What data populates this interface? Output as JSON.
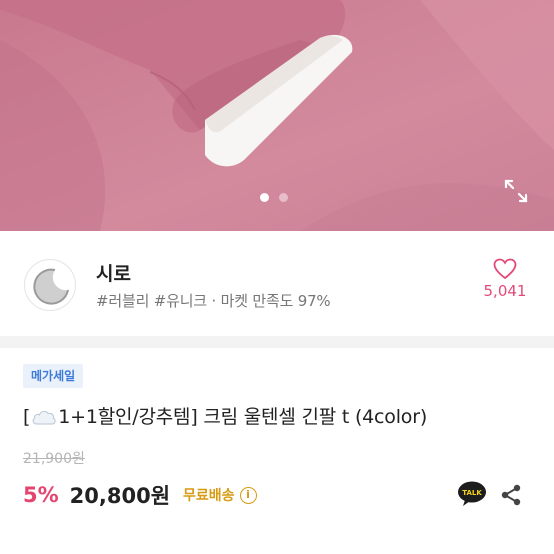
{
  "pager": {
    "count": 2,
    "active": 0
  },
  "seller": {
    "name": "시로",
    "tags": "#러블리 #유니크 · 마켓 만족도 97%",
    "like_count": "5,041"
  },
  "product": {
    "badge": "메가세일",
    "title_prefix": "[",
    "title_main": "1+1할인/강추템] 크림 울텐셀 긴팔 t (4color)",
    "original_price": "21,900원",
    "discount": "5%",
    "price": "20,800원",
    "shipping": "무료배송",
    "talk_label": "TALK"
  },
  "colors": {
    "accent_pink": "#e5446f",
    "badge_blue": "#3d7bd9",
    "shipping_gold": "#d79b14",
    "product_fabric": "#cf8397"
  },
  "icons": [
    "expand-icon",
    "heart-icon",
    "cloud-icon",
    "info-icon",
    "kakao-talk-icon",
    "share-icon"
  ]
}
